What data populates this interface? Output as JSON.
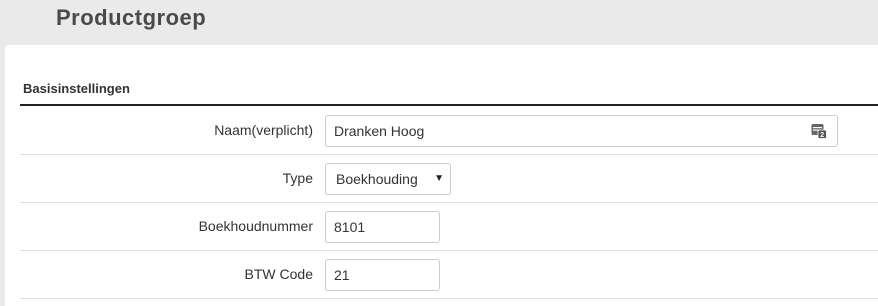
{
  "header": {
    "title": "Productgroep"
  },
  "section": {
    "title": "Basisinstellingen"
  },
  "fields": {
    "naam": {
      "label": "Naam(verplicht)",
      "value": "Dranken Hoog",
      "icon": "translate-icon"
    },
    "type": {
      "label": "Type",
      "selected": "Boekhouding",
      "icon": "caret-down-icon"
    },
    "boekhoudnummer": {
      "label": "Boekhoudnummer",
      "value": "8101"
    },
    "btw": {
      "label": "BTW Code",
      "value": "21"
    }
  }
}
